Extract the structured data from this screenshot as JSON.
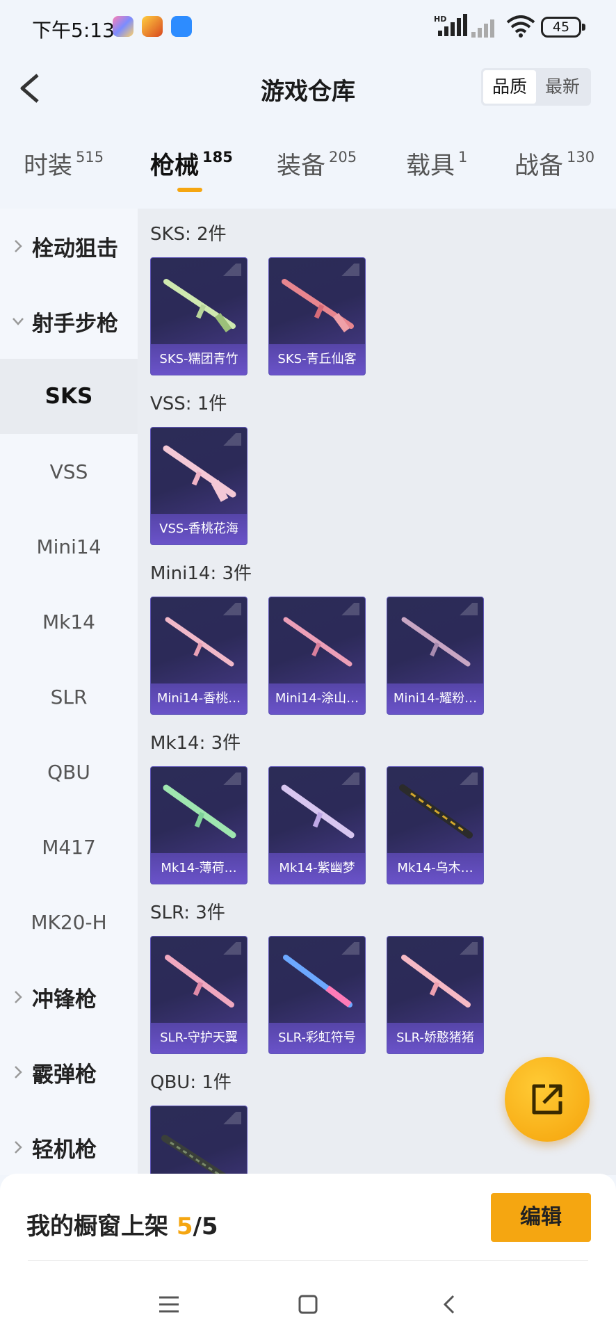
{
  "status_bar": {
    "time": "下午5:13",
    "battery": "45",
    "hd_label": "HD"
  },
  "header": {
    "title": "游戏仓库",
    "sort_options": [
      "品质",
      "最新"
    ]
  },
  "tabs": [
    {
      "label": "时装",
      "count": "515"
    },
    {
      "label": "枪械",
      "count": "185"
    },
    {
      "label": "装备",
      "count": "205"
    },
    {
      "label": "载具",
      "count": "1"
    },
    {
      "label": "战备",
      "count": "130"
    }
  ],
  "sidebar": {
    "items": [
      {
        "label": "栓动狙击"
      },
      {
        "label": "射手步枪"
      },
      {
        "label": "SKS"
      },
      {
        "label": "VSS"
      },
      {
        "label": "Mini14"
      },
      {
        "label": "Mk14"
      },
      {
        "label": "SLR"
      },
      {
        "label": "QBU"
      },
      {
        "label": "M417"
      },
      {
        "label": "MK20-H"
      },
      {
        "label": "冲锋枪"
      },
      {
        "label": "霰弹枪"
      },
      {
        "label": "轻机枪"
      }
    ]
  },
  "groups": [
    {
      "title": "SKS: 2件",
      "items": [
        "SKS-糯团青竹",
        "SKS-青丘仙客"
      ]
    },
    {
      "title": "VSS: 1件",
      "items": [
        "VSS-香桃花海"
      ]
    },
    {
      "title": "Mini14: 3件",
      "items": [
        "Mini14-香桃…",
        "Mini14-涂山…",
        "Mini14-耀粉…"
      ]
    },
    {
      "title": "Mk14: 3件",
      "items": [
        "Mk14-薄荷…",
        "Mk14-紫幽梦",
        "Mk14-乌木…"
      ]
    },
    {
      "title": "SLR: 3件",
      "items": [
        "SLR-守护天翼",
        "SLR-彩虹符号",
        "SLR-娇憨猪猪"
      ]
    },
    {
      "title": "QBU: 1件",
      "items": [
        ""
      ]
    }
  ],
  "bottom": {
    "shelf_label": "我的橱窗上架 ",
    "shelf_current": "5",
    "shelf_total": "/5",
    "edit_label": "编辑"
  }
}
